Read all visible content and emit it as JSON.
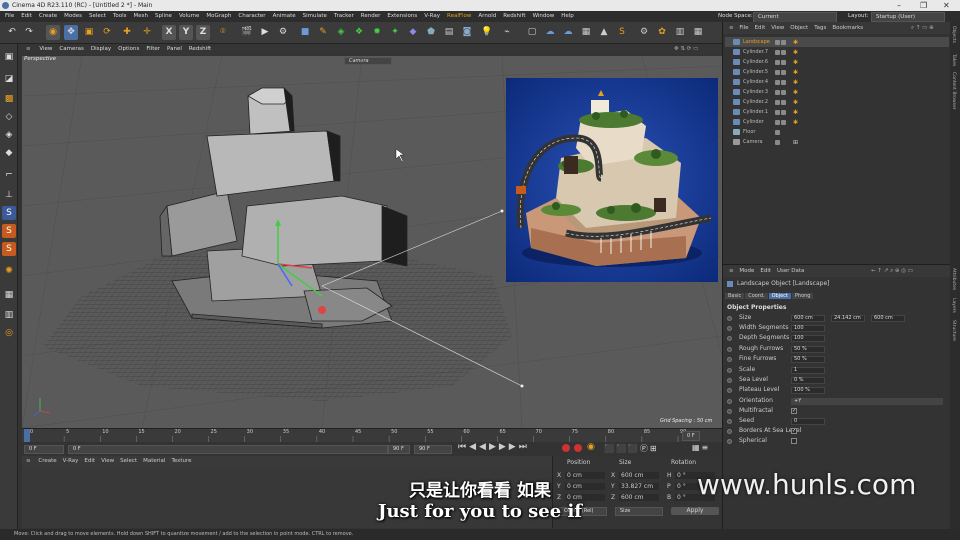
{
  "titlebar": {
    "title": "Cinema 4D R23.110 (RC) - [Untitled 2 *] - Main",
    "minimize": "–",
    "maximize": "❐",
    "close": "✕"
  },
  "menubar": {
    "items": [
      "File",
      "Edit",
      "Create",
      "Modes",
      "Select",
      "Tools",
      "Mesh",
      "Spline",
      "Volume",
      "MoGraph",
      "Character",
      "Animate",
      "Simulate",
      "Tracker",
      "Render",
      "Extensions",
      "V-Ray"
    ],
    "realflow": "RealFlow",
    "items2": [
      "Arnold",
      "Redshift",
      "Window",
      "Help"
    ],
    "node_space_label": "Node Space:",
    "node_space_value": "Current (Standard/Physical)",
    "layout_label": "Layout:",
    "layout_value": "Startup (User)"
  },
  "toolbar": {
    "x": "X",
    "y": "Y",
    "z": "Z",
    "brand_icons": "toolbar-icons"
  },
  "viewport_menu": [
    "View",
    "Cameras",
    "Display",
    "Options",
    "Filter",
    "Panel",
    "Redshift"
  ],
  "viewport": {
    "label": "Perspective",
    "camera_dropdown": "Camera",
    "grid_spacing": "Grid Spacing : 50 cm"
  },
  "timeline": {
    "ticks": [
      "0",
      "5",
      "10",
      "15",
      "20",
      "25",
      "30",
      "35",
      "40",
      "45",
      "50",
      "55",
      "60",
      "65",
      "70",
      "75",
      "80",
      "85",
      "90"
    ],
    "current_frame": "0 F"
  },
  "transport": {
    "start": "0 F",
    "start2": "0 F",
    "end": "90 F",
    "end2": "90 F"
  },
  "material_menu": [
    "Create",
    "V-Ray",
    "Edit",
    "View",
    "Select",
    "Material",
    "Texture"
  ],
  "coord": {
    "headers": [
      "Position",
      "Size",
      "Rotation"
    ],
    "rows": [
      {
        "axis": "X",
        "pos": "0 cm",
        "saxis": "X",
        "size": "600 cm",
        "raxis": "H",
        "rot": "0 °"
      },
      {
        "axis": "Y",
        "pos": "0 cm",
        "saxis": "Y",
        "size": "33.827 cm",
        "raxis": "P",
        "rot": "0 °"
      },
      {
        "axis": "Z",
        "pos": "0 cm",
        "saxis": "Z",
        "size": "600 cm",
        "raxis": "B",
        "rot": "0 °"
      }
    ],
    "mode1": "Object (Rel)",
    "mode2": "Size",
    "apply": "Apply"
  },
  "object_panel": {
    "menu": [
      "File",
      "Edit",
      "View",
      "Object",
      "Tags",
      "Bookmarks"
    ],
    "objects": [
      "Landscape",
      "Cylinder.7",
      "Cylinder.6",
      "Cylinder.5",
      "Cylinder.4",
      "Cylinder.3",
      "Cylinder.2",
      "Cylinder.1",
      "Cylinder",
      "Floor",
      "Camera"
    ]
  },
  "attributes": {
    "menu": [
      "Mode",
      "Edit",
      "User Data"
    ],
    "object_title": "Landscape Object [Landscape]",
    "tabs": [
      "Basic",
      "Coord.",
      "Object",
      "Phong"
    ],
    "section": "Object Properties",
    "size_label": "Size",
    "size_x": "600 cm",
    "size_y": "24.142 cm",
    "size_z": "600 cm",
    "props": [
      {
        "label": "Width Segments",
        "value": "100"
      },
      {
        "label": "Depth Segments",
        "value": "100"
      },
      {
        "label": "Rough Furrows",
        "value": "50 %"
      },
      {
        "label": "Fine Furrows",
        "value": "50 %"
      },
      {
        "label": "Scale",
        "value": "1"
      },
      {
        "label": "Sea Level",
        "value": "0 %"
      },
      {
        "label": "Plateau Level",
        "value": "100 %"
      }
    ],
    "orientation_label": "Orientation",
    "orientation_value": "+Y",
    "multifractal": "Multifractal",
    "seed_label": "Seed",
    "seed_value": "0",
    "borders": "Borders At Sea Level",
    "spherical": "Spherical"
  },
  "right_tabs": [
    "Objects",
    "Takes",
    "Content Browser",
    "Attributes",
    "Layers",
    "Structure"
  ],
  "statusbar": "Move: Click and drag to move elements. Hold down SHIFT to quantize movement / add to the selection in point mode. CTRL to remove.",
  "subtitles": {
    "chinese": "只是让你看看 如果",
    "english": "Just for you to see if"
  },
  "watermark": "www.hunls.com",
  "colors": {
    "accent": "#e8a020",
    "selection": "#4a6fa5",
    "x_axis": "#d44",
    "y_axis": "#4c4",
    "z_axis": "#46f"
  }
}
